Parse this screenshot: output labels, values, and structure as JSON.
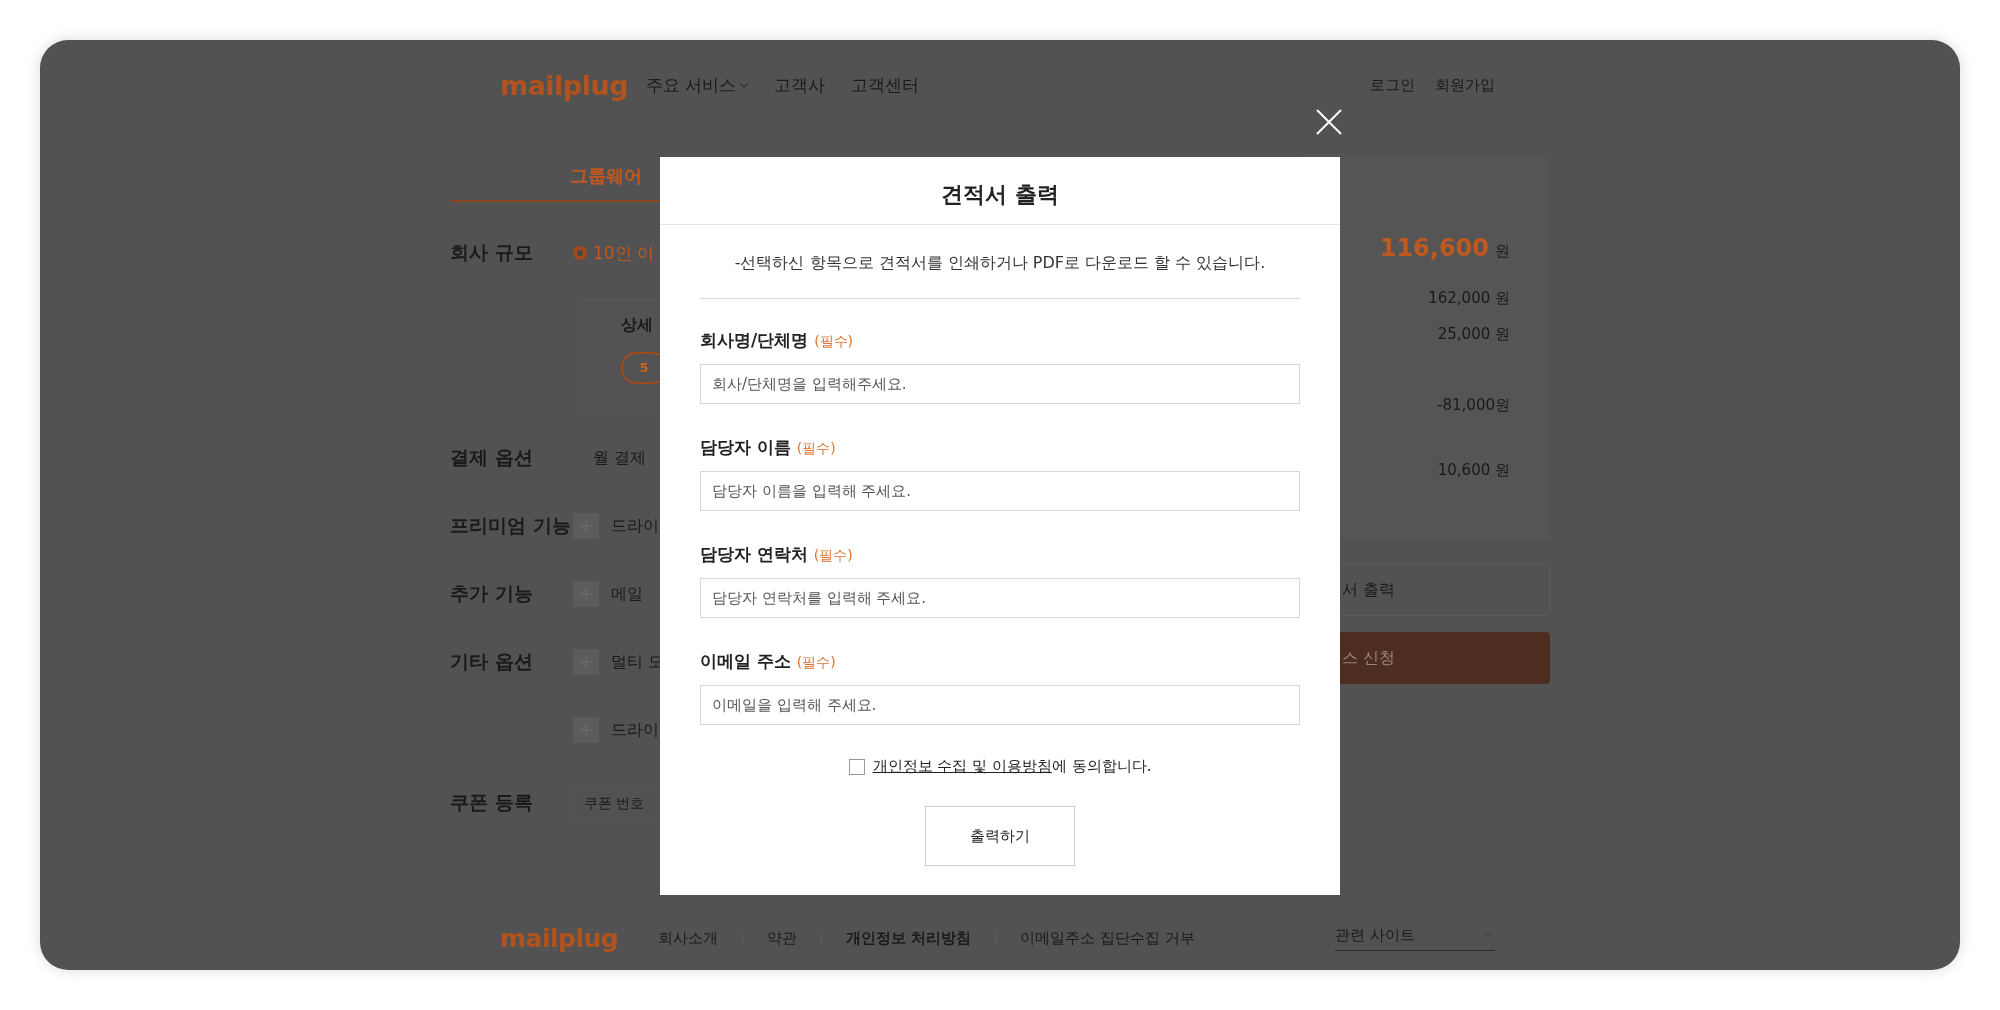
{
  "header": {
    "logo": "mailplug",
    "nav": [
      {
        "label": "주요 서비스",
        "has_dropdown": true
      },
      {
        "label": "고객사",
        "has_dropdown": false
      },
      {
        "label": "고객센터",
        "has_dropdown": false
      }
    ],
    "account_links": [
      "로그인",
      "회원가입"
    ]
  },
  "estimate": {
    "tabs": [
      {
        "label": "그룹웨어",
        "selected": true
      }
    ],
    "rows": [
      {
        "kind": "radio",
        "label": "회사 규모",
        "option": "10인 이",
        "selected": true
      },
      {
        "kind": "detail",
        "title": "상세",
        "pills": [
          {
            "label": "5",
            "selected": true
          }
        ]
      },
      {
        "kind": "text",
        "label": "결제 옵션",
        "value": "월 결제"
      },
      {
        "kind": "addon",
        "label": "프리미엄 기능",
        "option": "드라이"
      },
      {
        "kind": "addon",
        "label": "추가 기능",
        "option": "메일"
      },
      {
        "kind": "addon",
        "label": "기타 옵션",
        "option": "멀티 도"
      },
      {
        "kind": "addon",
        "option": "드라이"
      },
      {
        "kind": "coupon",
        "label": "쿠폰 등록",
        "placeholder": "쿠폰 번호"
      }
    ]
  },
  "summary": {
    "total": {
      "amount": "116,600",
      "unit": "원"
    },
    "lines": [
      "162,000 원",
      "25,000 원",
      "-81,000원",
      "10,600 원"
    ],
    "buttons": [
      {
        "kind": "outline",
        "label": "서 출력"
      },
      {
        "kind": "primary",
        "label": "스 신청"
      }
    ]
  },
  "modal": {
    "title": "견적서 출력",
    "description": "-선택하신 항목으로 견적서를 인쇄하거나 PDF로 다운로드 할 수 있습니다.",
    "fields": [
      {
        "label": "회사명/단체명",
        "tag": "(필수)",
        "placeholder": "회사/단체명을 입력해주세요."
      },
      {
        "label": "담당자 이름",
        "tag": "(필수)",
        "placeholder": "담당자 이름을 입력해 주세요."
      },
      {
        "label": "담당자 연락처",
        "tag": "(필수)",
        "placeholder": "담당자 연락처를 입력해 주세요."
      },
      {
        "label": "이메일 주소",
        "tag": "(필수)",
        "placeholder": "이메일을 입력해 주세요."
      }
    ],
    "agreement": {
      "checked": false,
      "link": "개인정보 수집 및 이용방침",
      "text": "에 동의합니다."
    },
    "submit": "출력하기"
  },
  "footer": {
    "logo": "mailplug",
    "links": [
      {
        "label": "회사소개",
        "bold": false
      },
      {
        "label": "약관",
        "bold": false
      },
      {
        "label": "개인정보 처리방침",
        "bold": true
      },
      {
        "label": "이메일주소 집단수집 거부",
        "bold": false
      }
    ],
    "related_sites": "관련 사이트"
  }
}
